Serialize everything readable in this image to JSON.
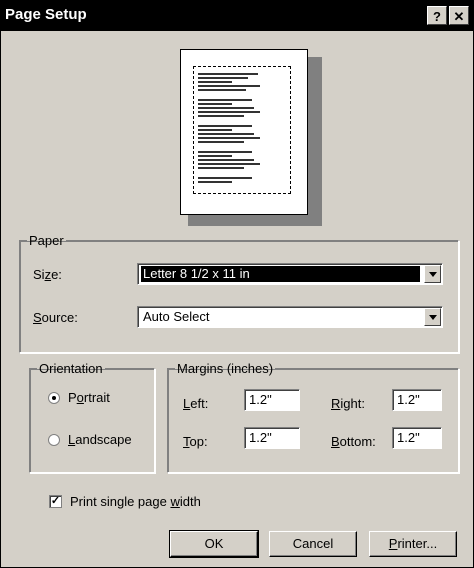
{
  "window": {
    "title": "Page Setup",
    "help_label": "?",
    "close_label": "✕"
  },
  "paper": {
    "legend": "Paper",
    "size_label": "Size:",
    "size_value": "Letter 8 1/2 x 11 in",
    "source_label": "Source:",
    "source_value": "Auto Select"
  },
  "orientation": {
    "legend": "Orientation",
    "portrait_label": "Portrait",
    "landscape_label": "Landscape",
    "selected": "Portrait"
  },
  "margins": {
    "legend": "Margins (inches)",
    "left_label": "Left:",
    "left_value": "1.2\"",
    "right_label": "Right:",
    "right_value": "1.2\"",
    "top_label": "Top:",
    "top_value": "1.2\"",
    "bottom_label": "Bottom:",
    "bottom_value": "1.2\""
  },
  "print_single_page_width": {
    "label": "Print single page width",
    "checked": true
  },
  "buttons": {
    "ok": "OK",
    "cancel": "Cancel",
    "printer": "Printer..."
  },
  "icons": {
    "combo_arrow": "chevron-down-icon",
    "check": "checkmark-icon"
  }
}
